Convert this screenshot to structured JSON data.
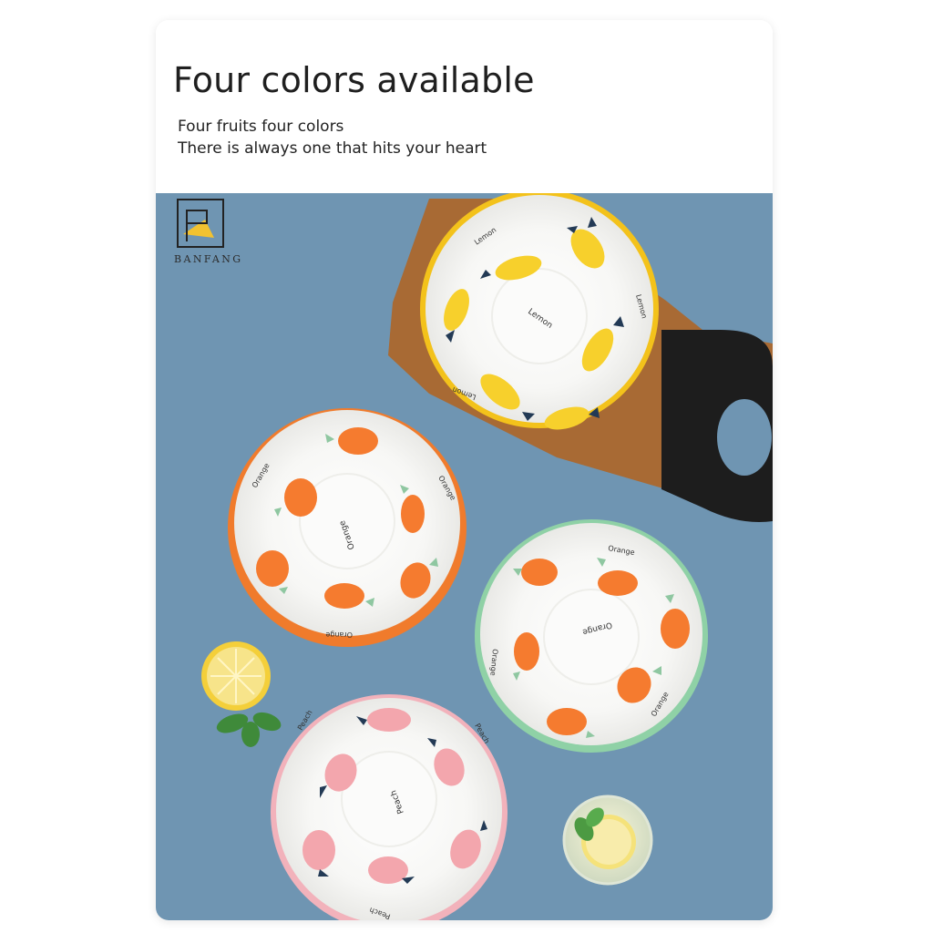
{
  "header": {
    "title": "Four colors available",
    "subtitle_line1": "Four fruits four colors",
    "subtitle_line2": "There is always one that hits your heart"
  },
  "brand": {
    "name": "BANFANG"
  },
  "bowls": {
    "lemon": {
      "rim_label": "Lemon",
      "center_label": "Lemon",
      "rim_color": "#f3c21b",
      "fruit_color": "#f7d02c"
    },
    "orange_left": {
      "rim_label": "Orange",
      "center_label": "Orange",
      "rim_color": "#f07b2c",
      "fruit_color": "#f57b2f"
    },
    "orange_right": {
      "rim_label": "Orange",
      "center_label": "Orange",
      "rim_color": "#8fd1a6",
      "fruit_color": "#f57b2f"
    },
    "peach": {
      "rim_label": "Peach",
      "center_label": "Peach",
      "rim_color": "#f2b2bb",
      "fruit_color": "#f3a6ad"
    }
  },
  "colors": {
    "background": "#6f95b2",
    "board_wood": "#a86a34",
    "board_dark": "#1d1d1d"
  }
}
